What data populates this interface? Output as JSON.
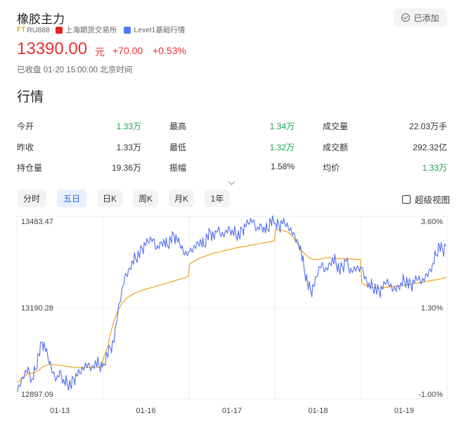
{
  "header": {
    "title": "橡胶主力",
    "ft_badge": "FT",
    "code": "RU888",
    "exchange": "上海期货交易所",
    "level_badge": "L1",
    "level": "Level1基础行情",
    "added_label": "已添加",
    "price": "13390.00",
    "unit": "元",
    "change": "+70.00",
    "change_pct": "+0.53%",
    "status": "已收盘 01-20 15:00:00 北京时间"
  },
  "section_title": "行情",
  "quote": {
    "rows": [
      [
        {
          "label": "今开",
          "value": "1.33万",
          "color": "green"
        },
        {
          "label": "最高",
          "value": "1.34万",
          "color": "green"
        },
        {
          "label": "成交量",
          "value": "22.03万手",
          "color": "dark"
        }
      ],
      [
        {
          "label": "昨收",
          "value": "1.33万",
          "color": "dark"
        },
        {
          "label": "最低",
          "value": "1.32万",
          "color": "green"
        },
        {
          "label": "成交额",
          "value": "292.32亿",
          "color": "dark"
        }
      ],
      [
        {
          "label": "持仓量",
          "value": "19.36万",
          "color": "dark"
        },
        {
          "label": "振幅",
          "value": "1.58%",
          "color": "dark"
        },
        {
          "label": "均价",
          "value": "1.33万",
          "color": "green"
        }
      ]
    ]
  },
  "tabs": [
    {
      "label": "分时",
      "active": false
    },
    {
      "label": "五日",
      "active": true
    },
    {
      "label": "日K",
      "active": false
    },
    {
      "label": "周K",
      "active": false
    },
    {
      "label": "月K",
      "active": false
    },
    {
      "label": "1年",
      "active": false
    }
  ],
  "fullscreen_label": "超级视图",
  "colors": {
    "up": "#e93030",
    "down": "#1aa34a",
    "price_line": "#4f6ef0",
    "avg_line": "#f2a21c",
    "active_tab": "#2f63d8"
  },
  "chart_data": {
    "type": "line",
    "y_left_ticks": [
      "13483.47",
      "13190.28",
      "12897.09"
    ],
    "y_right_ticks": [
      "3.60%",
      "1.30%",
      "-1.00%"
    ],
    "ylim": [
      12897.09,
      13483.47
    ],
    "x_labels": [
      "01-13",
      "01-16",
      "01-17",
      "01-18",
      "01-19"
    ],
    "grid": true,
    "series": [
      {
        "values": [
          [
            12920,
            12950,
            12980,
            13000,
            12960,
            12990,
            13040,
            13080,
            13050,
            13010,
            12980,
            12960,
            12990,
            12960,
            12950,
            12940,
            12960,
            12970,
            12980,
            13000,
            13010,
            13000,
            13020,
            13010,
            13000
          ],
          [
            13010,
            13040,
            13060,
            13080,
            13170,
            13230,
            13290,
            13310,
            13340,
            13350,
            13360,
            13380,
            13390,
            13400,
            13410,
            13380,
            13400,
            13410,
            13390,
            13410,
            13420,
            13400,
            13380,
            13360,
            13370
          ],
          [
            13370,
            13380,
            13400,
            13410,
            13390,
            13420,
            13430,
            13410,
            13440,
            13420,
            13430,
            13450,
            13440,
            13430,
            13420,
            13440,
            13450,
            13460,
            13470,
            13440,
            13460,
            13450,
            13440,
            13470,
            13460
          ],
          [
            13460,
            13450,
            13460,
            13450,
            13440,
            13430,
            13410,
            13390,
            13320,
            13270,
            13240,
            13260,
            13300,
            13330,
            13310,
            13330,
            13350,
            13340,
            13310,
            13320,
            13340,
            13300,
            13310,
            13320,
            13320
          ],
          [
            13320,
            13290,
            13270,
            13260,
            13250,
            13240,
            13250,
            13270,
            13260,
            13250,
            13260,
            13270,
            13280,
            13270,
            13260,
            13270,
            13280,
            13270,
            13290,
            13310,
            13330,
            13360,
            13390,
            13370,
            13390
          ]
        ]
      },
      {
        "values": [
          [
            12950,
            12962,
            12970,
            12978,
            12980,
            12982,
            12990,
            13000,
            13005,
            13008,
            13008,
            13006,
            13005,
            13004,
            13002,
            13000,
            12999,
            12998,
            12998,
            12998,
            12998,
            12998,
            12998,
            12999,
            13000
          ],
          [
            13030,
            13060,
            13110,
            13150,
            13180,
            13200,
            13215,
            13225,
            13232,
            13238,
            13242,
            13246,
            13250,
            13253,
            13256,
            13260,
            13263,
            13266,
            13270,
            13273,
            13276,
            13280,
            13283,
            13286,
            13290
          ],
          [
            13330,
            13338,
            13344,
            13350,
            13354,
            13358,
            13362,
            13366,
            13368,
            13371,
            13374,
            13376,
            13379,
            13382,
            13384,
            13386,
            13388,
            13390,
            13392,
            13394,
            13396,
            13398,
            13400,
            13402,
            13405
          ],
          [
            13440,
            13440,
            13438,
            13435,
            13428,
            13415,
            13398,
            13380,
            13365,
            13355,
            13348,
            13345,
            13345,
            13347,
            13350,
            13351,
            13350,
            13348,
            13348,
            13348,
            13347,
            13347,
            13346,
            13345,
            13345
          ],
          [
            13270,
            13262,
            13258,
            13255,
            13254,
            13253,
            13254,
            13256,
            13257,
            13259,
            13260,
            13261,
            13262,
            13264,
            13266,
            13268,
            13270,
            13272,
            13274,
            13276,
            13278,
            13280,
            13282,
            13285,
            13288
          ]
        ]
      }
    ]
  }
}
